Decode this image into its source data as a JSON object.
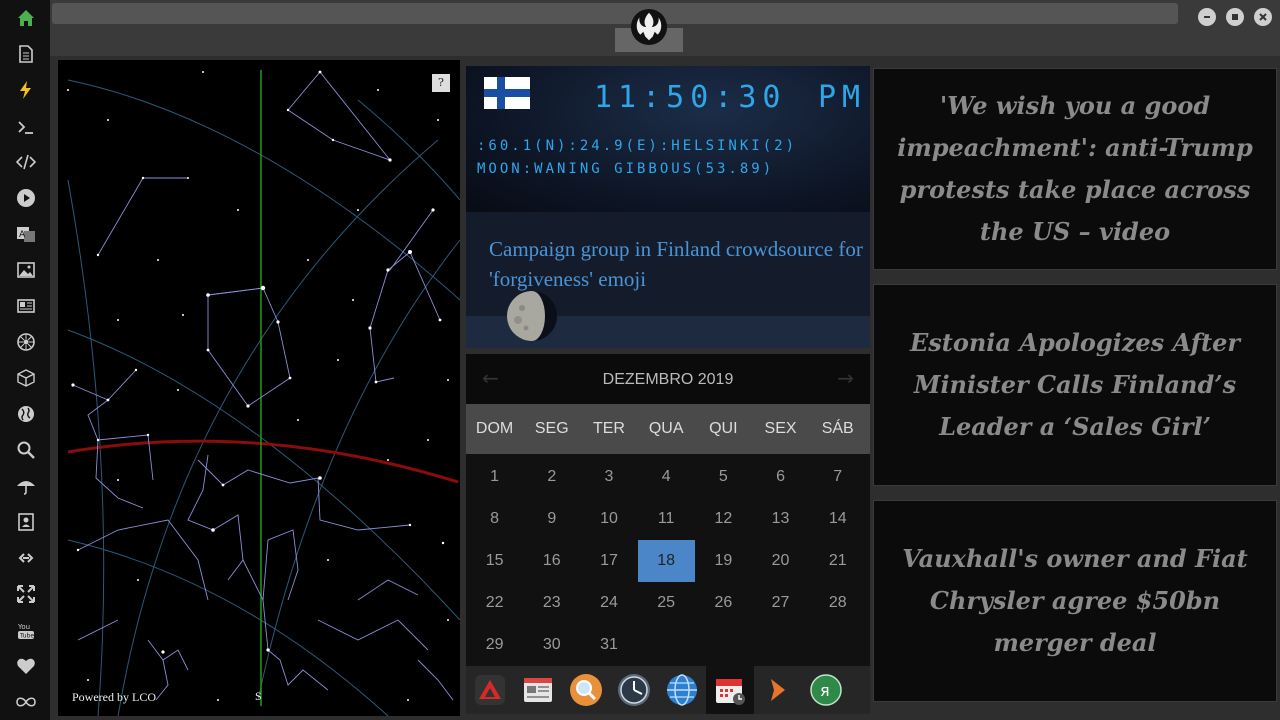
{
  "sidebar": {
    "icons": [
      "home-icon",
      "document-icon",
      "lightning-icon",
      "terminal-icon",
      "code-icon",
      "play-icon",
      "translate-icon",
      "image-icon",
      "news-icon",
      "settings-wheel-icon",
      "cube-icon",
      "globe-icon",
      "search-icon",
      "umbrella-icon",
      "contacts-icon",
      "link-icon",
      "expand-icon",
      "youtube-icon",
      "heart-icon",
      "infinity-icon"
    ],
    "youtube_label": "You Tube"
  },
  "window": {
    "logo": "rebel-alliance-logo"
  },
  "starmap": {
    "help_label": "?",
    "powered_by": "Powered by LCO",
    "direction": "S"
  },
  "clock": {
    "time": "11:50:30",
    "ampm": "PM",
    "location": ":60.1(N):24.9(E):HELSINKI(2)",
    "moon": "MOON:WANING GIBBOUS(53.89)",
    "flag": "finland"
  },
  "news": {
    "headline": "Campaign group in Finland crowdsource for 'forgiveness' emoji"
  },
  "calendar": {
    "month": "DEZEMBRO 2019",
    "prev": "←",
    "next": "→",
    "weekdays": [
      "DOM",
      "SEG",
      "TER",
      "QUA",
      "QUI",
      "SEX",
      "SÁB"
    ],
    "weeks": [
      [
        "1",
        "2",
        "3",
        "4",
        "5",
        "6",
        "7"
      ],
      [
        "8",
        "9",
        "10",
        "11",
        "12",
        "13",
        "14"
      ],
      [
        "15",
        "16",
        "17",
        "18",
        "19",
        "20",
        "21"
      ],
      [
        "22",
        "23",
        "24",
        "25",
        "26",
        "27",
        "28"
      ],
      [
        "29",
        "30",
        "31",
        "",
        "",
        "",
        ""
      ]
    ],
    "today": "18",
    "today_color": "#4a86c8"
  },
  "dock": [
    "red-triangle-app-icon",
    "news-reader-icon",
    "search-app-icon",
    "clock-app-icon",
    "globe-app-icon",
    "calendar-app-icon",
    "forward-arrow-icon",
    "yandex-icon"
  ],
  "headlines": [
    "'We wish you a good impeachment': anti-Trump protests take place across the US – video",
    "Estonia Apologizes After Minister Calls Finland’s Leader a ‘Sales Girl’",
    "Vauxhall's owner and Fiat Chrysler agree $50bn merger deal"
  ],
  "colors": {
    "accent": "#2ea6ea",
    "news_blue": "#4a94d6",
    "headline_gray": "#8a8a8a"
  }
}
